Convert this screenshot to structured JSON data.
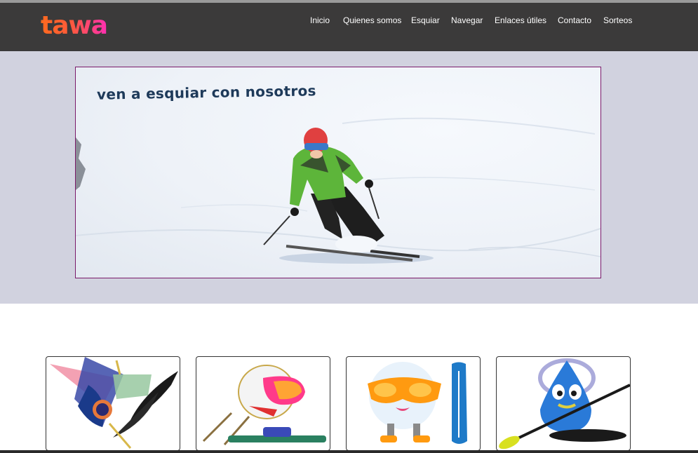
{
  "brand": {
    "logo_text": "tawa"
  },
  "nav": [
    {
      "label": "Inicio"
    },
    {
      "label": "Quienes somos"
    },
    {
      "label": "Esquiar"
    },
    {
      "label": "Navegar"
    },
    {
      "label": "Enlaces útiles"
    },
    {
      "label": "Contacto"
    },
    {
      "label": "Sorteos"
    }
  ],
  "hero": {
    "caption": "ven a esquiar con nosotros"
  },
  "colors": {
    "header_bg": "#3b3a3a",
    "hero_band_bg": "#d1d2df",
    "hero_border": "#7a1a6a",
    "caption_color": "#1e3a5a"
  }
}
